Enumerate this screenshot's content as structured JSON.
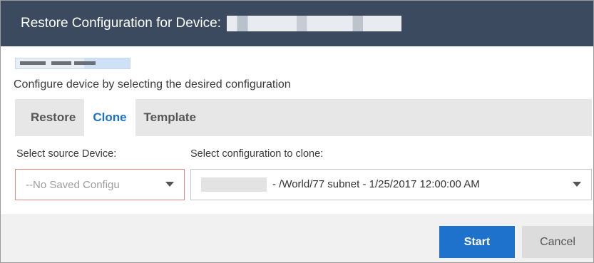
{
  "dialog": {
    "title": "Restore Configuration for Device:",
    "instruction": "Configure device by selecting the desired configuration"
  },
  "tabs": [
    {
      "label": "Restore",
      "active": false
    },
    {
      "label": "Clone",
      "active": true
    },
    {
      "label": "Template",
      "active": false
    }
  ],
  "source_device": {
    "label": "Select source Device:",
    "value": "--No Saved Configu"
  },
  "config_clone": {
    "label": "Select configuration to clone:",
    "value": "- /World/77 subnet - 1/25/2017 12:00:00 AM"
  },
  "buttons": {
    "start": "Start",
    "cancel": "Cancel"
  },
  "colors": {
    "titlebar": "#3b4a5e",
    "accent": "#1e72cc",
    "active_tab": "#1a73c9",
    "error_border": "#e0897f"
  }
}
